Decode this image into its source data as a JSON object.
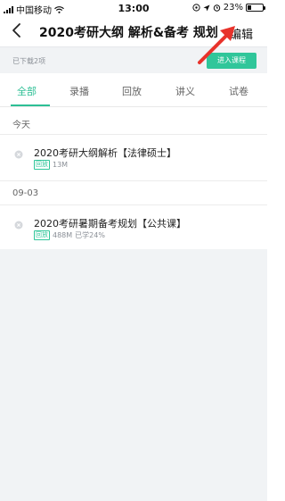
{
  "status_bar": {
    "carrier": "中国移动",
    "time": "13:00",
    "battery_text": "23%",
    "battery_level": 0.23,
    "icons": [
      "signal-icon",
      "wifi-icon",
      "location-icon",
      "alarm-icon",
      "battery-icon"
    ]
  },
  "nav": {
    "title": "2020考研大纲 解析&备考 规划",
    "edit_label": "编辑",
    "back_icon": "chevron-left-icon"
  },
  "info_bar": {
    "downloaded_text": "已下载2项",
    "enter_course_label": "进入课程"
  },
  "tabs": [
    {
      "label": "全部",
      "active": true
    },
    {
      "label": "录播",
      "active": false
    },
    {
      "label": "回放",
      "active": false
    },
    {
      "label": "讲义",
      "active": false
    },
    {
      "label": "试卷",
      "active": false
    }
  ],
  "sections": [
    {
      "header": "今天",
      "items": [
        {
          "title": "2020考研大纲解析【法律硕士】",
          "badge": "回放",
          "size": "13M",
          "progress": ""
        }
      ]
    },
    {
      "header": "09-03",
      "items": [
        {
          "title": "2020考研暑期备考规划【公共课】",
          "badge": "回放",
          "size": "488M",
          "progress": "已学24%"
        }
      ]
    }
  ],
  "colors": {
    "accent": "#30c69a",
    "tab_active": "#2dbf95",
    "annotation_arrow": "#e8322b",
    "background": "#f1f3f5"
  }
}
